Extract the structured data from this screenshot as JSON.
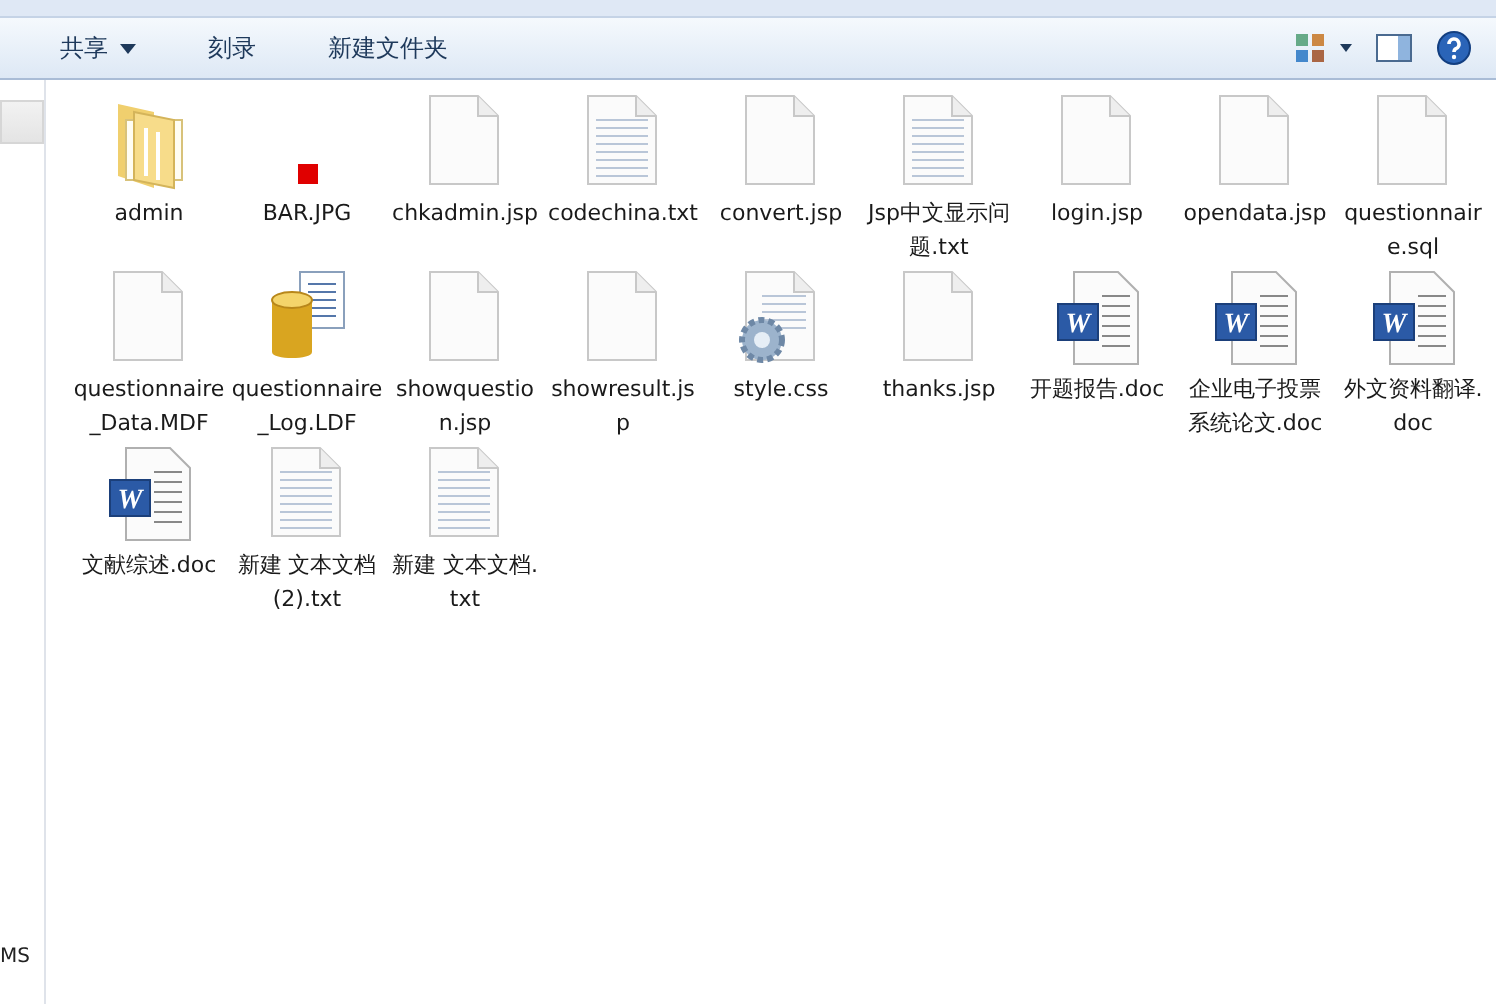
{
  "toolbar": {
    "buttons": [
      {
        "label": "共享",
        "has_menu": true
      },
      {
        "label": "刻录",
        "has_menu": false
      },
      {
        "label": "新建文件夹",
        "has_menu": false
      }
    ]
  },
  "sidebar": {
    "items": [
      {
        "selected": true
      },
      {
        "label": "MS",
        "selected": false
      }
    ]
  },
  "files": [
    {
      "name": "admin",
      "kind": "folder"
    },
    {
      "name": "BAR.JPG",
      "kind": "image"
    },
    {
      "name": "chkadmin.jsp",
      "kind": "blank"
    },
    {
      "name": "codechina.txt",
      "kind": "text"
    },
    {
      "name": "convert.jsp",
      "kind": "blank"
    },
    {
      "name": "Jsp中文显示问题.txt",
      "kind": "text"
    },
    {
      "name": "login.jsp",
      "kind": "blank"
    },
    {
      "name": "opendata.jsp",
      "kind": "blank"
    },
    {
      "name": "questionnaire.sql",
      "kind": "blank"
    },
    {
      "name": "questionnaire_Data.MDF",
      "kind": "blank"
    },
    {
      "name": "questionnaire_Log.LDF",
      "kind": "database"
    },
    {
      "name": "showquestion.jsp",
      "kind": "blank"
    },
    {
      "name": "showresult.jsp",
      "kind": "blank"
    },
    {
      "name": "style.css",
      "kind": "config"
    },
    {
      "name": "thanks.jsp",
      "kind": "blank"
    },
    {
      "name": "开题报告.doc",
      "kind": "word",
      "badge": "W"
    },
    {
      "name": "企业电子投票系统论文.doc",
      "kind": "word",
      "badge": "W"
    },
    {
      "name": "外文资料翻译.doc",
      "kind": "word",
      "badge": "W"
    },
    {
      "name": "文献综述.doc",
      "kind": "word",
      "badge": "W"
    },
    {
      "name": "新建 文本文档 (2).txt",
      "kind": "text"
    },
    {
      "name": "新建 文本文档.txt",
      "kind": "text"
    }
  ]
}
